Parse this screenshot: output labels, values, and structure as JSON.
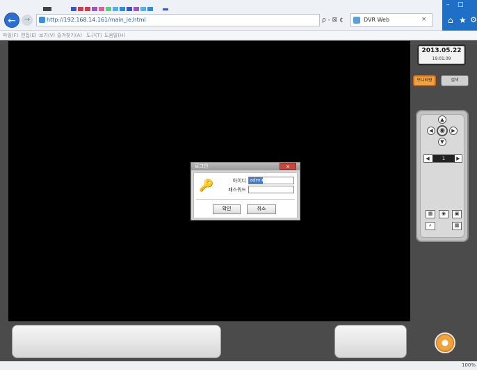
{
  "browser": {
    "url": "http://192.168.14.161/main_ie.html",
    "search_tools": "ρ - ⊠ ¢",
    "tab_title": "DVR Web",
    "tab_close": "×",
    "menu": [
      "파일(F)",
      "편집(E)",
      "보기(V)",
      "즐겨찾기(A)",
      "도구(T)",
      "도움말(H)"
    ],
    "zoom_level": "100%",
    "icons": {
      "back": "back-arrow-icon",
      "forward": "forward-arrow-icon",
      "home": "home-icon",
      "favorites": "star-icon",
      "settings": "gear-icon"
    },
    "accent_color": "#1f6fc6"
  },
  "dvr": {
    "date": "2013.05.22",
    "time": "19:01:09",
    "live_label": "모니터링",
    "search_label": "검색",
    "zoom_value": "1",
    "ptz_icons": [
      "up-arrow-icon",
      "down-arrow-icon",
      "left-arrow-icon",
      "right-arrow-icon",
      "center-icon"
    ],
    "colors": {
      "active_button": "#f0a23c",
      "panel": "#c3c3c3"
    }
  },
  "dialog": {
    "title": "로그인",
    "close_label": "✕",
    "id_label": "아이디",
    "id_value": "admin",
    "password_label": "패스워드",
    "password_value": "",
    "ok_label": "확인",
    "cancel_label": "취소"
  }
}
